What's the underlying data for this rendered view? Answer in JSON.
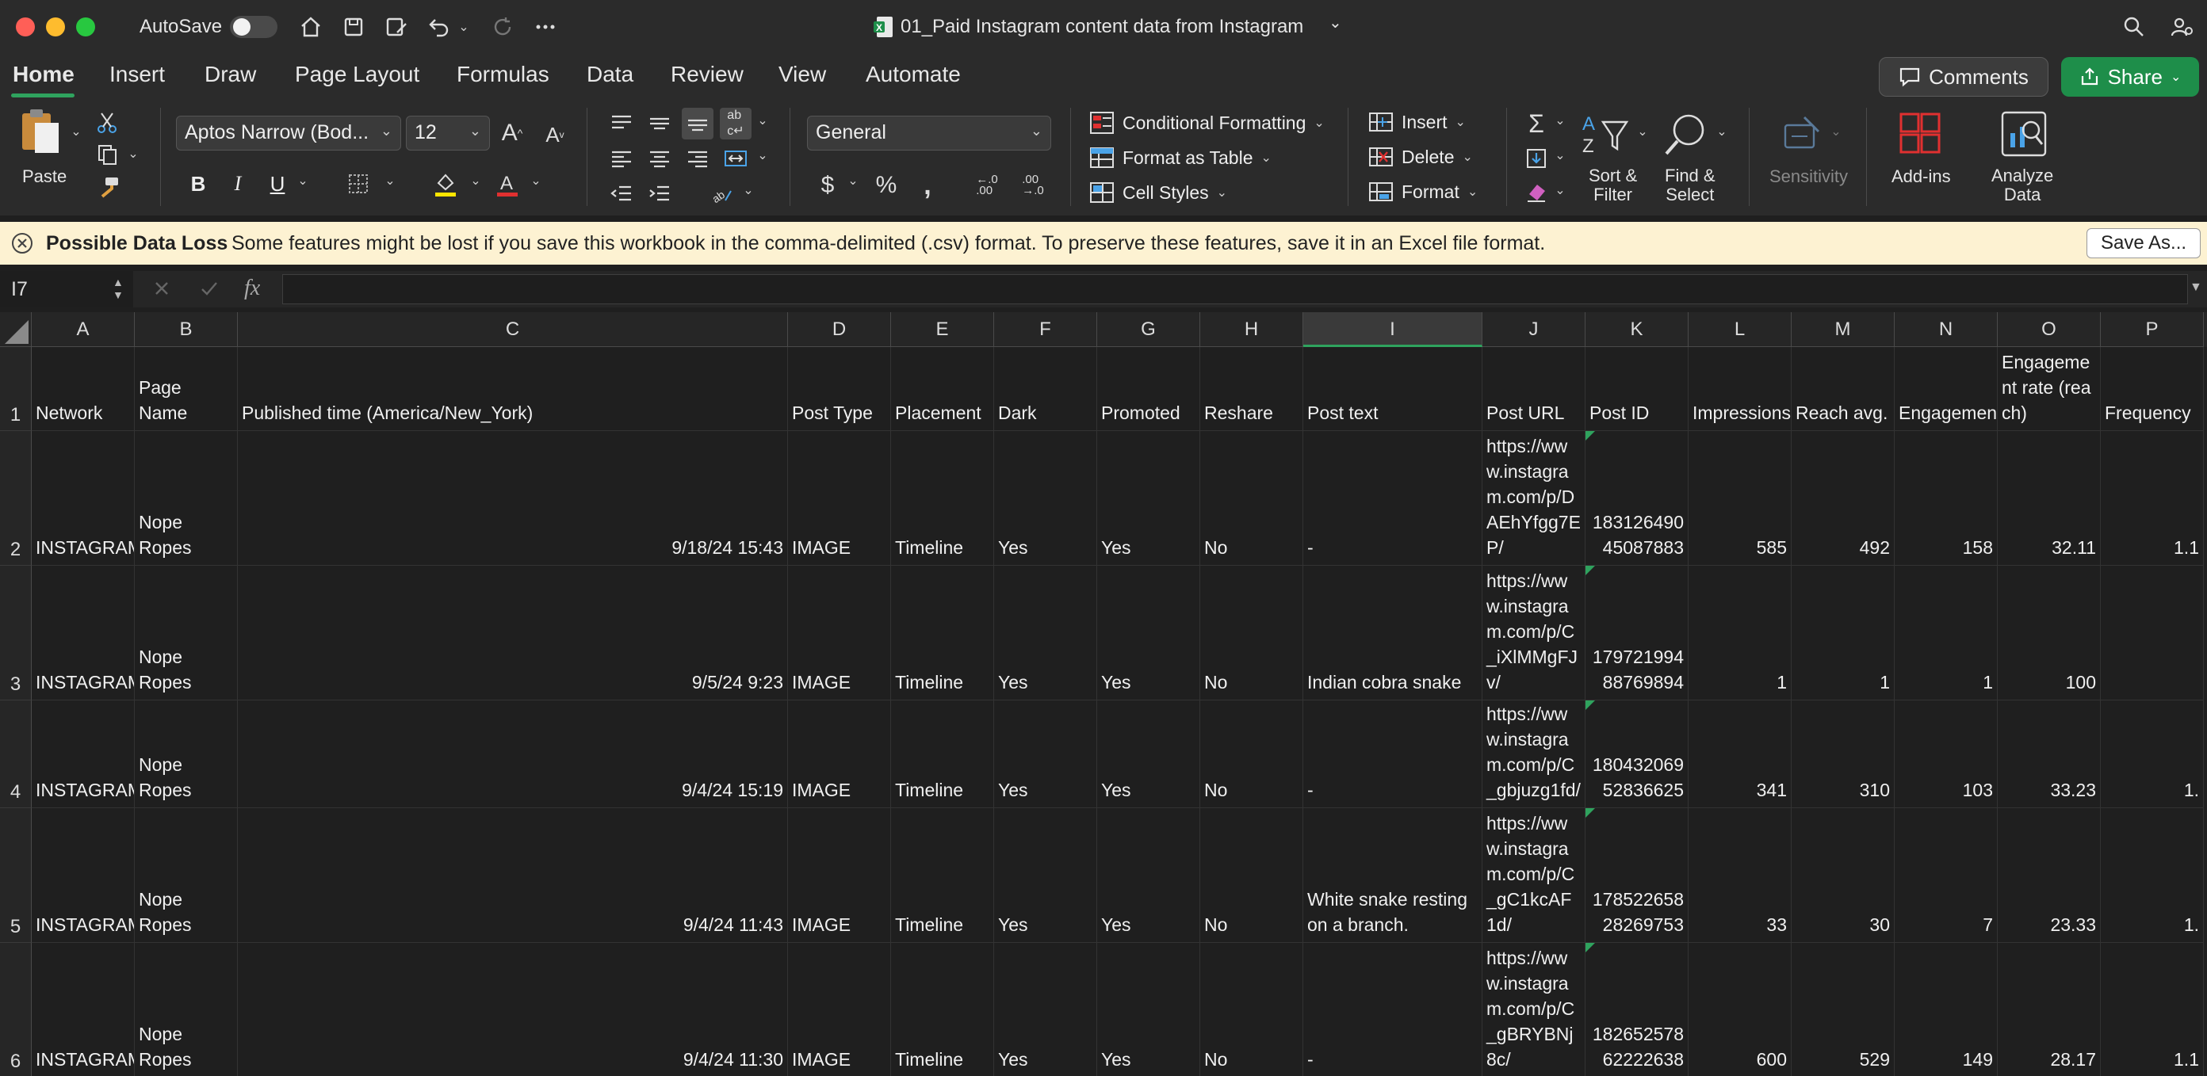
{
  "app": {
    "autosave_label": "AutoSave",
    "doc_title": "01_Paid Instagram content data from Instagram",
    "colors": {
      "accent": "#2fa35e",
      "share": "#1e8e4a",
      "infobar": "#fdf2d2"
    }
  },
  "tabs": [
    {
      "label": "Home",
      "active": true
    },
    {
      "label": "Insert"
    },
    {
      "label": "Draw"
    },
    {
      "label": "Page Layout"
    },
    {
      "label": "Formulas"
    },
    {
      "label": "Data"
    },
    {
      "label": "Review"
    },
    {
      "label": "View"
    },
    {
      "label": "Automate"
    }
  ],
  "actions": {
    "comments": "Comments",
    "share": "Share"
  },
  "ribbon": {
    "paste": "Paste",
    "font_name": "Aptos Narrow (Bod...",
    "font_size": "12",
    "number_format": "General",
    "conditional_formatting": "Conditional Formatting",
    "format_as_table": "Format as Table",
    "cell_styles": "Cell Styles",
    "insert": "Insert",
    "delete": "Delete",
    "format": "Format",
    "sort_filter_1": "Sort &",
    "sort_filter_2": "Filter",
    "find_select_1": "Find &",
    "find_select_2": "Select",
    "sensitivity": "Sensitivity",
    "addins": "Add-ins",
    "analyze_1": "Analyze",
    "analyze_2": "Data",
    "bold": "B",
    "italic": "I",
    "underline": "U"
  },
  "infobar": {
    "title": "Possible Data Loss",
    "message": "Some features might be lost if you save this workbook in the comma-delimited (.csv) format. To preserve these features, save it in an Excel file format.",
    "save_as": "Save As..."
  },
  "formula": {
    "name_box": "I7",
    "fx": "fx",
    "value": ""
  },
  "columns": [
    "A",
    "B",
    "C",
    "D",
    "E",
    "F",
    "G",
    "H",
    "I",
    "J",
    "K",
    "L",
    "M",
    "N",
    "O",
    "P"
  ],
  "rows": [
    {
      "num": "1",
      "cells": [
        "Network",
        "Page Name",
        "Published time (America/New_York)",
        "Post Type",
        "Placement",
        "Dark",
        "Promoted",
        "Reshare",
        "Post text",
        "Post URL",
        "Post ID",
        "Impressions",
        "Reach avg.",
        "Engagements",
        "Engagement rate (reach)",
        "Frequency"
      ]
    },
    {
      "num": "2",
      "cells": [
        "INSTAGRAM",
        "Nope Ropes",
        "9/18/24 15:43",
        "IMAGE",
        "Timeline",
        "Yes",
        "Yes",
        "No",
        "-",
        "https://www.instagram.com/p/DAEhYfgg7EP/",
        "18312649045087883",
        "585",
        "492",
        "158",
        "32.11",
        "1.1"
      ]
    },
    {
      "num": "3",
      "cells": [
        "INSTAGRAM",
        "Nope Ropes",
        "9/5/24 9:23",
        "IMAGE",
        "Timeline",
        "Yes",
        "Yes",
        "No",
        "Indian cobra snake",
        "https://www.instagram.com/p/C_iXlMMgFJv/",
        "17972199488769894",
        "1",
        "1",
        "1",
        "100",
        ""
      ]
    },
    {
      "num": "4",
      "cells": [
        "INSTAGRAM",
        "Nope Ropes",
        "9/4/24 15:19",
        "IMAGE",
        "Timeline",
        "Yes",
        "Yes",
        "No",
        "-",
        "https://www.instagram.com/p/C_gbjuzg1fd/",
        "18043206952836625",
        "341",
        "310",
        "103",
        "33.23",
        "1."
      ]
    },
    {
      "num": "5",
      "cells": [
        "INSTAGRAM",
        "Nope Ropes",
        "9/4/24 11:43",
        "IMAGE",
        "Timeline",
        "Yes",
        "Yes",
        "No",
        "White snake resting on a branch.",
        "https://www.instagram.com/p/C_gC1kcAF1d/",
        "17852265828269753",
        "33",
        "30",
        "7",
        "23.33",
        "1."
      ]
    },
    {
      "num": "6",
      "cells": [
        "INSTAGRAM",
        "Nope Ropes",
        "9/4/24 11:30",
        "IMAGE",
        "Timeline",
        "Yes",
        "Yes",
        "No",
        "-",
        "https://www.instagram.com/p/C_gBRYBNj8c/",
        "18265257862222638",
        "600",
        "529",
        "149",
        "28.17",
        "1.1"
      ]
    }
  ]
}
